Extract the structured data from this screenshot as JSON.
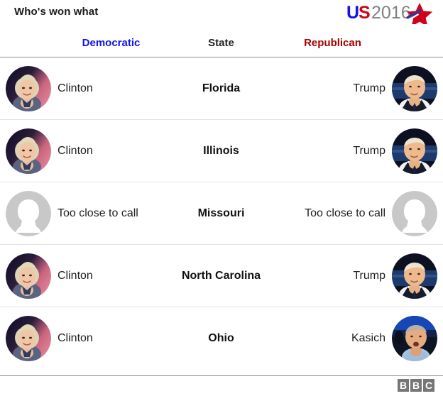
{
  "header": {
    "title": "Who's won what",
    "logo": {
      "name": "us2016-logo",
      "part_u": "U",
      "part_s": "S",
      "part_year": "2016",
      "star_icon": "star-icon",
      "color_u": "#1111EE",
      "color_s": "#D0021B",
      "color_year": "#808080",
      "color_star_red": "#D0021B",
      "color_star_blue": "#2B3A9E"
    }
  },
  "columns": {
    "democratic": {
      "label": "Democratic",
      "color": "#1111EE"
    },
    "state": {
      "label": "State",
      "color": "#222222"
    },
    "republican": {
      "label": "Republican",
      "color": "#A90000"
    }
  },
  "rows": [
    {
      "state": "Florida",
      "democratic": {
        "name": "Clinton",
        "avatar": "clinton-photo"
      },
      "republican": {
        "name": "Trump",
        "avatar": "trump-photo"
      }
    },
    {
      "state": "Illinois",
      "democratic": {
        "name": "Clinton",
        "avatar": "clinton-photo"
      },
      "republican": {
        "name": "Trump",
        "avatar": "trump-photo"
      }
    },
    {
      "state": "Missouri",
      "democratic": {
        "name": "Too close to call",
        "avatar": "placeholder-silhouette"
      },
      "republican": {
        "name": "Too close to call",
        "avatar": "placeholder-silhouette"
      }
    },
    {
      "state": "North Carolina",
      "democratic": {
        "name": "Clinton",
        "avatar": "clinton-photo"
      },
      "republican": {
        "name": "Trump",
        "avatar": "trump-photo"
      }
    },
    {
      "state": "Ohio",
      "democratic": {
        "name": "Clinton",
        "avatar": "clinton-photo"
      },
      "republican": {
        "name": "Kasich",
        "avatar": "kasich-photo"
      }
    }
  ],
  "footer": {
    "bbc_logo": [
      "B",
      "B",
      "C"
    ]
  }
}
